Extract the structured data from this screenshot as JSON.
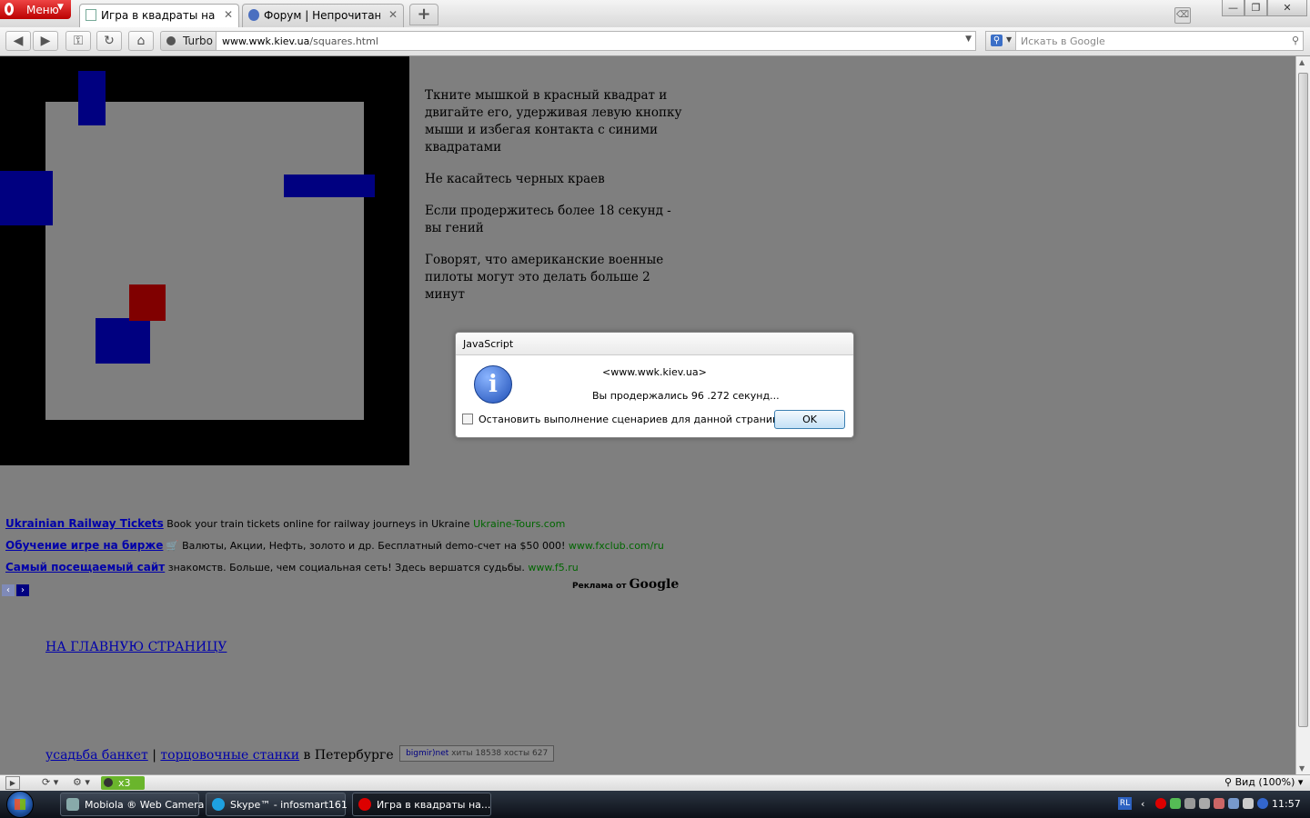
{
  "browser": {
    "menu_label": "Меню",
    "tabs": [
      {
        "title": "Игра в квадраты на ва...",
        "active": true
      },
      {
        "title": "Форум | Непрочитанное",
        "active": false
      }
    ],
    "new_tab_symbol": "+",
    "window_controls": {
      "minimize": "—",
      "restore": "❐",
      "close": "✕"
    },
    "turbo_label": "Turbo",
    "url_host": "www.wwk.kiev.ua",
    "url_path": "/squares.html",
    "search_placeholder": "Искать в Google"
  },
  "page": {
    "instructions": [
      "Ткните мышкой в красный квадрат и двигайте его, удерживая левую кнопку мыши и избегая контакта с синими квадратами",
      "Не касайтесь черных краев",
      "Если продержитесь более 18 секунд - вы гений",
      "Говорят, что американские военные пилоты могут это делать больше 2 минут"
    ],
    "ads": [
      {
        "title": "Ukrainian Railway Tickets",
        "text": "Book your train tickets online for railway journeys in Ukraine",
        "url": "Ukraine-Tours.com"
      },
      {
        "title": "Обучение игре на бирже",
        "text": "Валюты, Акции, Нефть, золото и др. Бесплатный demo-счет на $50 000!",
        "url": "www.fxclub.com/ru"
      },
      {
        "title": "Самый посещаемый сайт",
        "text": "знакомств. Больше, чем социальная сеть! Здесь вершатся судьбы.",
        "url": "www.f5.ru"
      }
    ],
    "ads_by_prefix": "Реклама от",
    "ads_by_brand": "Google",
    "home_link": "НА ГЛАВНУЮ СТРАНИЦУ",
    "footer": {
      "link1": "усадьба банкет",
      "separator": "|",
      "link2": "торцовочные станки",
      "suffix": "в Петербурге",
      "counter_brand": "bigmir)net",
      "counter_text": "хиты 18538 хосты 627"
    },
    "colors": {
      "blue_square": "#000080",
      "red_square": "#800000",
      "border": "#000000"
    }
  },
  "dialog": {
    "title": "JavaScript",
    "source": "<www.wwk.kiev.ua>",
    "message": "Вы продержались 96 .272 секунд...",
    "checkbox_label": "Остановить выполнение сценариев для данной страницы",
    "ok_label": "OK",
    "icon": "info-icon"
  },
  "statusbar": {
    "turbo_badge": "x3",
    "zoom": "Вид (100%)"
  },
  "taskbar": {
    "tasks": [
      "Mobiola ® Web Camera",
      "Skype™ - infosmart161",
      "Игра в квадраты на..."
    ],
    "language": "RL",
    "clock": "11:57"
  }
}
